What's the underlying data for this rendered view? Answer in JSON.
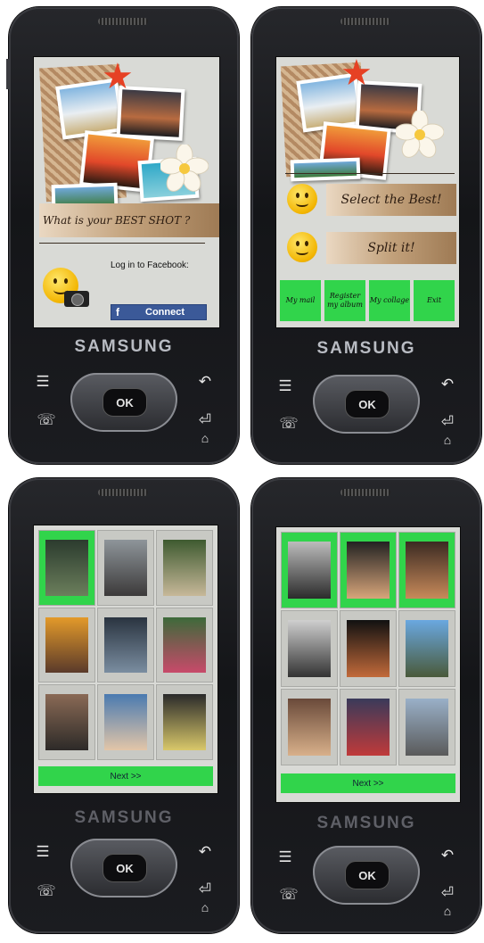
{
  "brand": "SAMSUNG",
  "ok_label": "OK",
  "keys": {
    "menu": "☰",
    "back": "↶",
    "home": "⌂",
    "call": "☏",
    "end": "⏎"
  },
  "phone1": {
    "question": "What is your BEST SHOT ?",
    "login_text": "Log in to Facebook:",
    "connect_button": "Connect",
    "fb_logo": "f"
  },
  "phone2": {
    "select_best": "Select the Best!",
    "split_it": "Split it!",
    "buttons": [
      "My mail",
      "Register my album",
      "My collage",
      "Exit"
    ]
  },
  "phone3": {
    "next": "Next >>",
    "selected": [
      0
    ]
  },
  "phone4": {
    "next": "Next >>",
    "selected": [
      0,
      1,
      2
    ]
  },
  "colors": {
    "accent_green": "#31d44b",
    "facebook_blue": "#3b5998",
    "body_black": "#151619"
  }
}
